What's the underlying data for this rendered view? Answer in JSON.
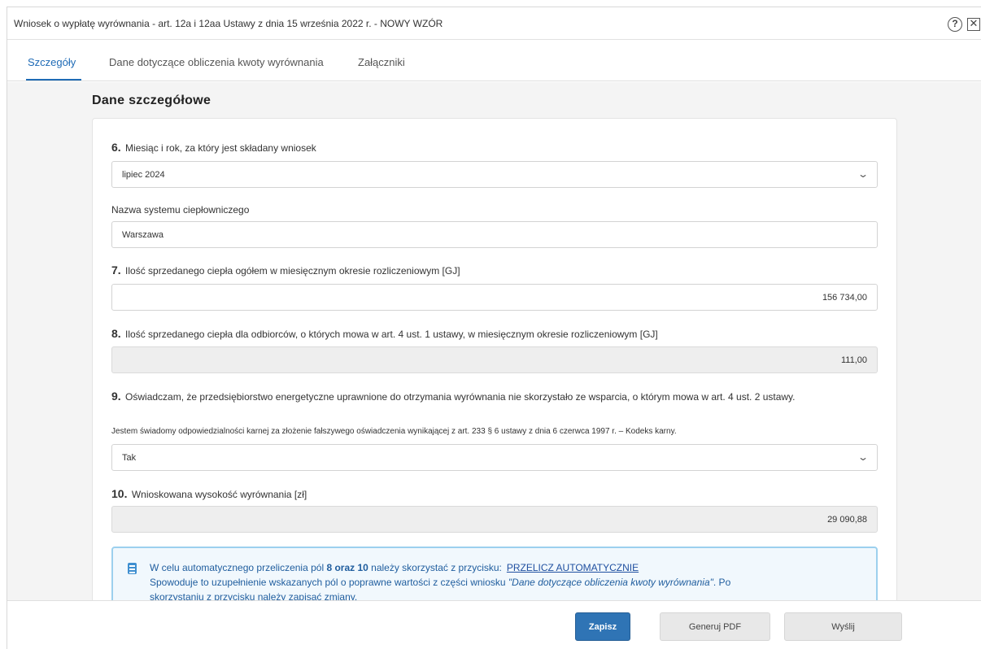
{
  "window": {
    "title": "Wniosek o wypłatę wyrównania - art. 12a i 12aa Ustawy z dnia 15 września 2022 r. - NOWY WZÓR",
    "help_symbol": "?",
    "close_symbol": "✕"
  },
  "tabs": [
    {
      "label": "Szczegóły",
      "active": true
    },
    {
      "label": "Dane dotyczące obliczenia kwoty wyrównania",
      "active": false
    },
    {
      "label": "Załączniki",
      "active": false
    }
  ],
  "section_title": "Dane szczegółowe",
  "fields": {
    "f6": {
      "num": "6.",
      "label": "Miesiąc i rok, za który jest składany wniosek",
      "value": "lipiec 2024",
      "chevron": "⌄"
    },
    "system": {
      "label": "Nazwa systemu ciepłowniczego",
      "value": "Warszawa"
    },
    "f7": {
      "num": "7.",
      "label": "Ilość sprzedanego ciepła ogółem w miesięcznym okresie rozliczeniowym [GJ]",
      "value": "156 734,00"
    },
    "f8": {
      "num": "8.",
      "label": "Ilość sprzedanego ciepła dla odbiorców, o których mowa w art. 4 ust. 1 ustawy, w miesięcznym okresie rozliczeniowym [GJ]",
      "value": "111,00"
    },
    "f9": {
      "num": "9.",
      "label": "Oświadczam, że przedsiębiorstwo energetyczne uprawnione do otrzymania wyrównania nie skorzystało ze wsparcia, o którym mowa w art. 4 ust. 2 ustawy.",
      "note": "Jestem świadomy odpowiedzialności karnej za złożenie fałszywego oświadczenia wynikającej z art. 233 § 6 ustawy z dnia 6 czerwca 1997 r. – Kodeks karny.",
      "value": "Tak",
      "chevron": "⌄"
    },
    "f10": {
      "num": "10.",
      "label": "Wnioskowana wysokość wyrównania [zł]",
      "value": "29 090,88"
    }
  },
  "info": {
    "line1_pre": "W celu automatycznego przeliczenia pól ",
    "line1_bold": "8 oraz 10",
    "line1_post": " należy skorzystać z przycisku:",
    "link": "PRZELICZ AUTOMATYCZNIE",
    "line2_pre": "Spowoduje to uzupełnienie wskazanych pól o poprawne wartości z części wniosku ",
    "line2_italic": "\"Dane dotyczące obliczenia kwoty wyrównania\"",
    "line2_post": ". Po",
    "line3": "skorzystaniu z przycisku należy zapisać zmiany."
  },
  "buttons": {
    "save": "Zapisz",
    "pdf": "Generuj PDF",
    "send": "Wyślij"
  },
  "colors": {
    "accent": "#1f6bb6",
    "primary_button": "#2f74b5",
    "info_border": "#9cd0ee"
  }
}
